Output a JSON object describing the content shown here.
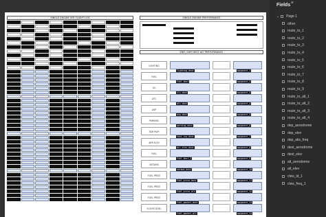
{
  "fields_panel": {
    "title": "Fields",
    "close_label": "×",
    "page_node": "Page 1",
    "items": [
      "other",
      "route_to_1",
      "route_to_2",
      "route_to_3",
      "route_to_4",
      "route_to_5",
      "route_to_6",
      "route_to_7",
      "route_to_8",
      "route_to_9",
      "route_to_alt_1",
      "route_to_alt_2",
      "route_to_alt_3",
      "route_to_alt_4",
      "dep_aerodrome",
      "dep_elev",
      "dep_atis_freq",
      "dest_aerodrome",
      "dest_elev",
      "alt_aerodrome",
      "alt_elev",
      "clws_id_1",
      "clws_freq_1"
    ]
  },
  "document": {
    "left_header": "SINGLE ENGINE VFR FLIGHT LOG",
    "right_header": "SINGLE ENGINE PERFORMANCE",
    "right_sub": "ENR / DEP DEST ALT PERFORMANCE",
    "right_rows": [
      "LIGHTING",
      "FUEL",
      "ILS",
      "ATC",
      "ASP",
      "PARKING",
      "TAXI RWY",
      "ARR ELEV",
      "FUEL",
      "NOTAMS",
      "FUEL PRICE",
      "FUEL PRICE",
      "FUEL PRICE",
      "FLIGHTLEVEL"
    ],
    "right_fields": [
      "lighting_dest",
      "fuel_dest",
      "ils_dest",
      "atc_dest",
      "asp_dest",
      "parking_dest",
      "taxi_rwy_dest",
      "arr_elev_dest",
      "fuel_dest_2",
      "notams_dest",
      "fuel_price_dest",
      "fuel_price_alt",
      "fuel_packet_dest",
      "fuel_packet_alt"
    ],
    "right_way": [
      "waypoint_1",
      "waypoint_2",
      "waypoint_3",
      "waypoint_4",
      "waypoint_5",
      "waypoint_6",
      "waypoint_7",
      "waypoint_8",
      "waypoint_9",
      "waypoint_10",
      "waypoint_11",
      "waypoint_12",
      "waypoint_13",
      "waypoint_14"
    ]
  },
  "colors": {
    "field_fill": "#d9e1f7",
    "redaction": "#111111",
    "panel_bg": "#2b2b2b"
  },
  "icons": {
    "fields_item": "field-checkbox-icon",
    "page_chevron": "chevron-down-icon"
  }
}
